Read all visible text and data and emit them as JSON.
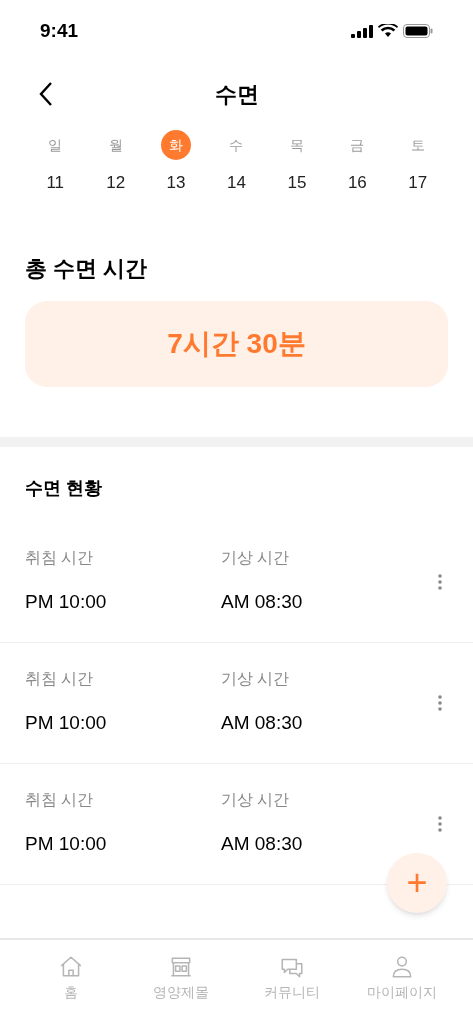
{
  "status_bar": {
    "time": "9:41"
  },
  "header": {
    "title": "수면"
  },
  "week": [
    {
      "day": "일",
      "date": "11",
      "selected": false
    },
    {
      "day": "월",
      "date": "12",
      "selected": false
    },
    {
      "day": "화",
      "date": "13",
      "selected": true
    },
    {
      "day": "수",
      "date": "14",
      "selected": false
    },
    {
      "day": "목",
      "date": "15",
      "selected": false
    },
    {
      "day": "금",
      "date": "16",
      "selected": false
    },
    {
      "day": "토",
      "date": "17",
      "selected": false
    }
  ],
  "total": {
    "title": "총 수면 시간",
    "value": "7시간 30분"
  },
  "records": {
    "title": "수면 현황",
    "rows": [
      {
        "bed_label": "취침 시간",
        "bed_time": "PM 10:00",
        "wake_label": "기상 시간",
        "wake_time": "AM 08:30"
      },
      {
        "bed_label": "취침 시간",
        "bed_time": "PM 10:00",
        "wake_label": "기상 시간",
        "wake_time": "AM 08:30"
      },
      {
        "bed_label": "취침 시간",
        "bed_time": "PM 10:00",
        "wake_label": "기상 시간",
        "wake_time": "AM 08:30"
      }
    ]
  },
  "fab": {
    "label": "+"
  },
  "bottom_nav": [
    {
      "kind": "home",
      "label": "홈"
    },
    {
      "kind": "store",
      "label": "영양제몰"
    },
    {
      "kind": "chat",
      "label": "커뮤니티"
    },
    {
      "kind": "person",
      "label": "마이페이지"
    }
  ]
}
